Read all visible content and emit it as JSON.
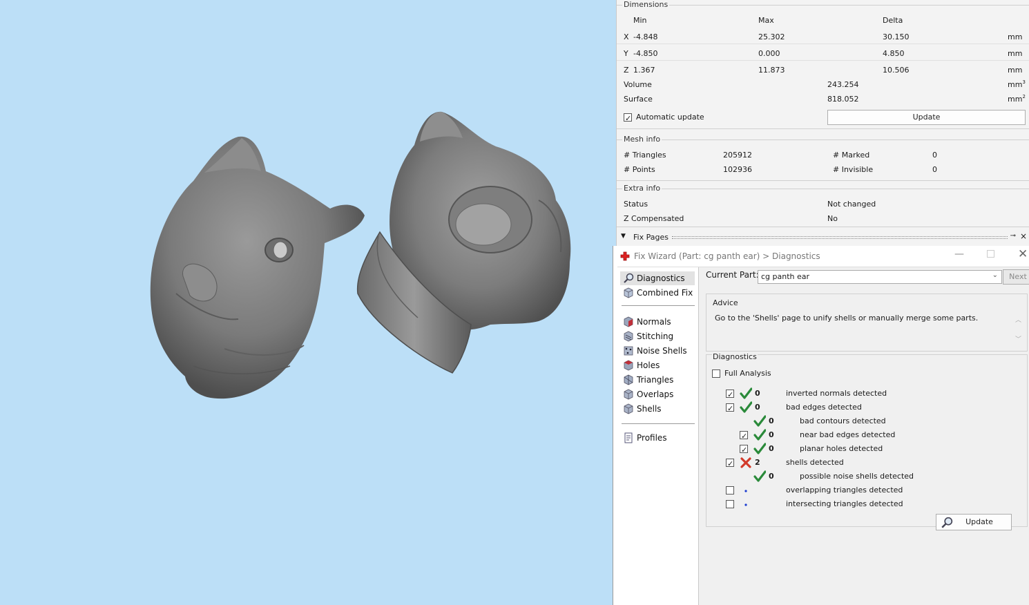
{
  "dimensions": {
    "title": "Dimensions",
    "headers": [
      "Min",
      "Max",
      "Delta"
    ],
    "rows": [
      {
        "axis": "X",
        "min": "-4.848",
        "max": "25.302",
        "delta": "30.150",
        "unit": "mm"
      },
      {
        "axis": "Y",
        "min": "-4.850",
        "max": "0.000",
        "delta": "4.850",
        "unit": "mm"
      },
      {
        "axis": "Z",
        "min": "1.367",
        "max": "11.873",
        "delta": "10.506",
        "unit": "mm"
      }
    ],
    "volume_label": "Volume",
    "volume_value": "243.254",
    "volume_unit": "mm",
    "volume_exp": "3",
    "surface_label": "Surface",
    "surface_value": "818.052",
    "surface_unit": "mm",
    "surface_exp": "2",
    "auto_update_label": "Automatic update",
    "auto_update_checked": true,
    "update_button": "Update"
  },
  "mesh_info": {
    "title": "Mesh info",
    "triangles_label": "# Triangles",
    "triangles_value": "205912",
    "points_label": "# Points",
    "points_value": "102936",
    "marked_label": "# Marked",
    "marked_value": "0",
    "invisible_label": "# Invisible",
    "invisible_value": "0"
  },
  "extra_info": {
    "title": "Extra info",
    "status_label": "Status",
    "status_value": "Not changed",
    "zcomp_label": "Z Compensated",
    "zcomp_value": "No"
  },
  "fix_pages": {
    "label": "Fix Pages",
    "pin_icon": "pin-icon",
    "close_icon": "close-icon"
  },
  "wizard": {
    "title": "Fix Wizard (Part: cg panth ear) > Diagnostics",
    "title_icon": "red-cross-icon",
    "nav": [
      {
        "label": "Diagnostics",
        "icon": "magnifier-icon",
        "selected": true
      },
      {
        "label": "Combined Fix",
        "icon": "cube-icon"
      },
      {
        "label": "Normals",
        "icon": "normals-cube-icon"
      },
      {
        "label": "Stitching",
        "icon": "stitching-cube-icon"
      },
      {
        "label": "Noise Shells",
        "icon": "noise-shells-icon"
      },
      {
        "label": "Holes",
        "icon": "holes-cube-icon"
      },
      {
        "label": "Triangles",
        "icon": "triangles-cube-icon"
      },
      {
        "label": "Overlaps",
        "icon": "overlaps-cube-icon"
      },
      {
        "label": "Shells",
        "icon": "shells-cube-icon"
      },
      {
        "label": "Profiles",
        "icon": "profile-document-icon"
      }
    ],
    "current_part_label": "Current Part:",
    "current_part_value": "cg panth ear",
    "next_button": "Next",
    "advice_label": "Advice",
    "advice_text": "Go to the 'Shells' page to unify shells or manually merge some parts.",
    "diagnostics_label": "Diagnostics",
    "full_analysis_label": "Full Analysis",
    "full_analysis_checked": false,
    "items": [
      {
        "checked": true,
        "has_checkbox": true,
        "status": "ok",
        "count": "0",
        "text": "inverted normals detected",
        "indent": 0
      },
      {
        "checked": true,
        "has_checkbox": true,
        "status": "ok",
        "count": "0",
        "text": "bad edges detected",
        "indent": 0
      },
      {
        "checked": false,
        "has_checkbox": false,
        "status": "ok",
        "count": "0",
        "text": "bad contours detected",
        "indent": 1
      },
      {
        "checked": true,
        "has_checkbox": true,
        "status": "ok",
        "count": "0",
        "text": "near bad edges detected",
        "indent": 1
      },
      {
        "checked": true,
        "has_checkbox": true,
        "status": "ok",
        "count": "0",
        "text": "planar holes detected",
        "indent": 1
      },
      {
        "checked": true,
        "has_checkbox": true,
        "status": "error",
        "count": "2",
        "text": "shells detected",
        "indent": 0
      },
      {
        "checked": false,
        "has_checkbox": false,
        "status": "ok",
        "count": "0",
        "text": "possible noise shells detected",
        "indent": 1
      },
      {
        "checked": false,
        "has_checkbox": true,
        "status": "none",
        "count": "",
        "text": "overlapping triangles detected",
        "indent": 0
      },
      {
        "checked": false,
        "has_checkbox": true,
        "status": "none",
        "count": "",
        "text": "intersecting triangles detected",
        "indent": 0
      }
    ],
    "update_button": "Update"
  },
  "colors": {
    "viewport_bg": "#bcdff7",
    "ok_check": "#2a8a3a",
    "error_cross": "#d23a2a",
    "unknown_dot": "#1a3ad0"
  }
}
